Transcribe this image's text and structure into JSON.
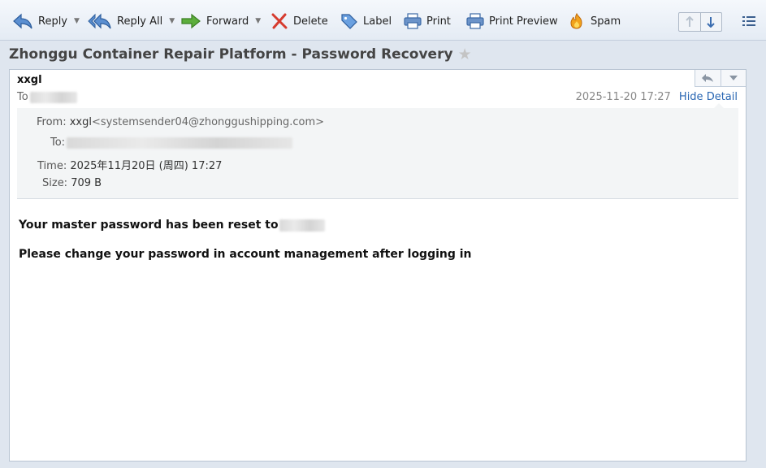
{
  "toolbar": {
    "reply": "Reply",
    "reply_all": "Reply All",
    "forward": "Forward",
    "delete": "Delete",
    "label": "Label",
    "print": "Print",
    "print_preview": "Print Preview",
    "spam": "Spam"
  },
  "subject": "Zhonggu Container Repair Platform - Password Recovery",
  "message": {
    "sender": "xxgl",
    "to_prefix": "To",
    "date": "2025-11-20 17:27",
    "hide_detail": "Hide Detail",
    "details": {
      "from_label": "From:",
      "from_name": "xxgl",
      "from_email": "<systemsender04@zhonggushipping.com>",
      "to_label": "To:",
      "time_label": "Time:",
      "time_value": "2025年11月20日 (周四) 17:27",
      "size_label": "Size:",
      "size_value": "709 B"
    },
    "body": {
      "line1": "Your master password has been reset to",
      "line2": "Please change your password in account management after logging in"
    }
  },
  "colors": {
    "link": "#2a67b3",
    "toolbar_bg": "#e9eff6",
    "page_bg": "#dfe6ef"
  }
}
